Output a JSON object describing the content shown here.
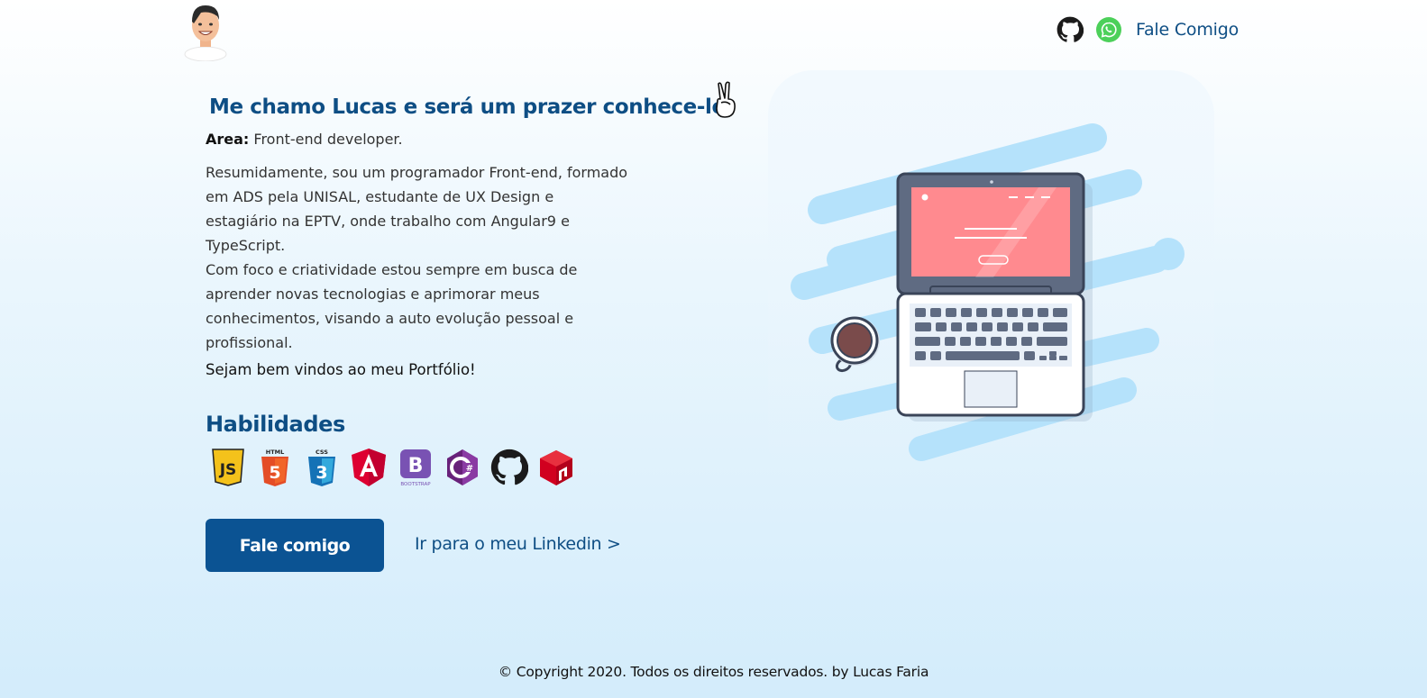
{
  "header": {
    "contact_link": "Fale Comigo",
    "icons": [
      "avatar",
      "github-icon",
      "whatsapp-icon"
    ]
  },
  "hero": {
    "intro": "Me chamo Lucas e será um prazer conhece-lo.",
    "area_label": "Area:",
    "area_value": " Front-end developer.",
    "bio_1": "Resumidamente, sou um programador Front-end, formado em ADS pela UNISAL, estudante de UX Design e estagiário na EPTV, onde trabalho com Angular9 e TypeScript.",
    "bio_2": "Com foco e criatividade estou sempre em busca de aprender novas tecnologias e aprimorar meus conhecimentos, visando a auto evolução pessoal e profissional.",
    "welcome": "Sejam bem vindos ao meu Portfólio!"
  },
  "skills": {
    "title": "Habilidades",
    "items": [
      "javascript-icon",
      "html5-icon",
      "css3-icon",
      "angular-icon",
      "bootstrap-icon",
      "csharp-icon",
      "github-icon",
      "nodemon-icon"
    ]
  },
  "actions": {
    "primary_button": "Fale comigo",
    "linkedin_link": "Ir para o meu Linkedin >"
  },
  "footer": {
    "copyright": "© Copyright 2020. Todos os direitos reservados. by Lucas Faria"
  },
  "colors": {
    "primary": "#0b5393",
    "heading": "#0e4e84",
    "whatsapp": "#4cd05a",
    "screen": "#ff8a8f",
    "splash": "#b5e2fb"
  }
}
